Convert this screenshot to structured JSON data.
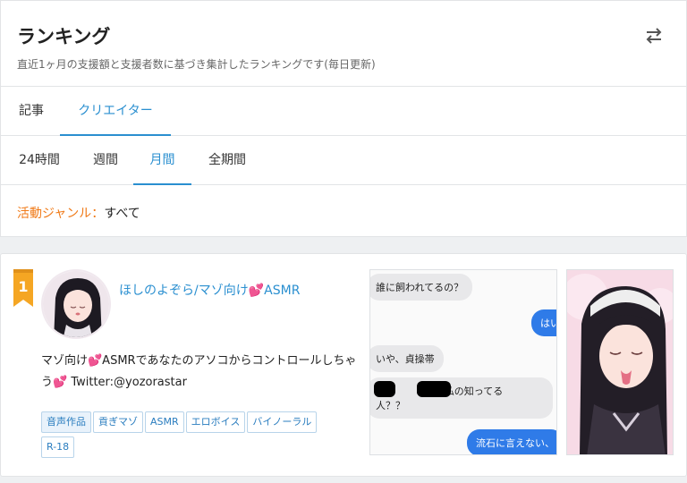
{
  "header": {
    "title": "ランキング",
    "subtitle": "直近1ヶ月の支援額と支援者数に基づき集計したランキングです(毎日更新)",
    "swap_icon": "swap-arrows-icon"
  },
  "content_tabs": [
    {
      "label": "記事",
      "active": false
    },
    {
      "label": "クリエイター",
      "active": true
    }
  ],
  "period_tabs": [
    {
      "label": "24時間",
      "active": false
    },
    {
      "label": "週間",
      "active": false
    },
    {
      "label": "月間",
      "active": true
    },
    {
      "label": "全期間",
      "active": false
    }
  ],
  "genre_filter": {
    "label": "活動ジャンル：",
    "value": "すべて"
  },
  "ranking": [
    {
      "rank": "1",
      "name": "ほしのよぞら/マゾ向け💕ASMR",
      "description": "マゾ向け💕ASMRであなたのアソコからコントロールしちゃう💕 Twitter:@yozorastar",
      "tags": [
        "音声作品",
        "貢ぎマゾ",
        "ASMR",
        "エロボイス",
        "バイノーラル",
        "R-18"
      ],
      "thumbnail_chat": [
        {
          "side": "left",
          "text": "誰に飼われてるの？"
        },
        {
          "side": "right",
          "text": "はい"
        },
        {
          "side": "left",
          "text": "いや、貞操帯"
        },
        {
          "side": "left",
          "text": "とか　　とか、私の知ってる"
        },
        {
          "side": "left",
          "text": "人？？"
        },
        {
          "side": "right",
          "text": "流石に言えない、"
        }
      ]
    }
  ],
  "colors": {
    "accent": "#2a8fd0",
    "genre_label": "#f07a18",
    "rank_gold": "#f5a623"
  }
}
